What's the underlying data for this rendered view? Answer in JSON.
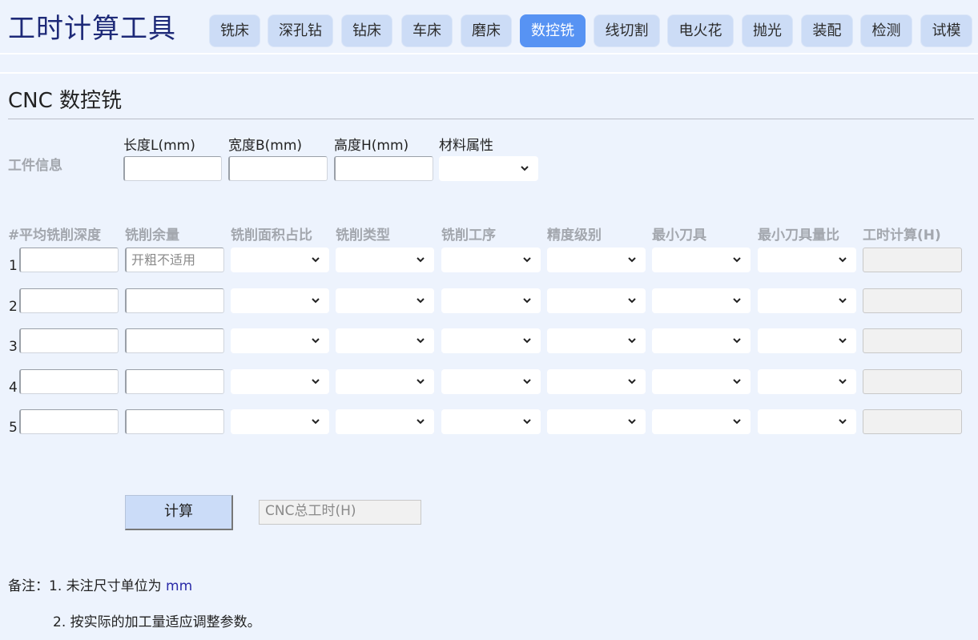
{
  "app_title": "工时计算工具",
  "nav": {
    "tabs": [
      "铣床",
      "深孔钻",
      "钻床",
      "车床",
      "磨床",
      "数控铣",
      "线切割",
      "电火花",
      "抛光",
      "装配",
      "检测",
      "试模"
    ],
    "active": "数控铣"
  },
  "page_title": "CNC 数控铣",
  "workpiece": {
    "section_label": "工件信息",
    "length_label": "长度L(mm)",
    "width_label": "宽度B(mm)",
    "height_label": "高度H(mm)",
    "material_label": "材料属性"
  },
  "table": {
    "num_header": "#",
    "headers": [
      "平均铣削深度",
      "铣削余量",
      "铣削面积占比",
      "铣削类型",
      "铣削工序",
      "精度级别",
      "最小刀具",
      "最小刀具量比",
      "工时计算(H)"
    ],
    "rows": [
      {
        "num": "1",
        "allowance_placeholder": "开粗不适用"
      },
      {
        "num": "2",
        "allowance_placeholder": ""
      },
      {
        "num": "3",
        "allowance_placeholder": ""
      },
      {
        "num": "4",
        "allowance_placeholder": ""
      },
      {
        "num": "5",
        "allowance_placeholder": ""
      }
    ]
  },
  "calc_button": "计算",
  "total_placeholder": "CNC总工时(H)",
  "notes": {
    "prefix": "备注：",
    "line1": "1. 未注尺寸单位为 ",
    "line1_unit": "mm",
    "line2": "2. 按实际的加工量适应调整参数。"
  },
  "colors": {
    "background": "#edf3fd",
    "tab": "#ccdcf6",
    "tab_active": "#5793f3",
    "title": "#1e2a78"
  }
}
